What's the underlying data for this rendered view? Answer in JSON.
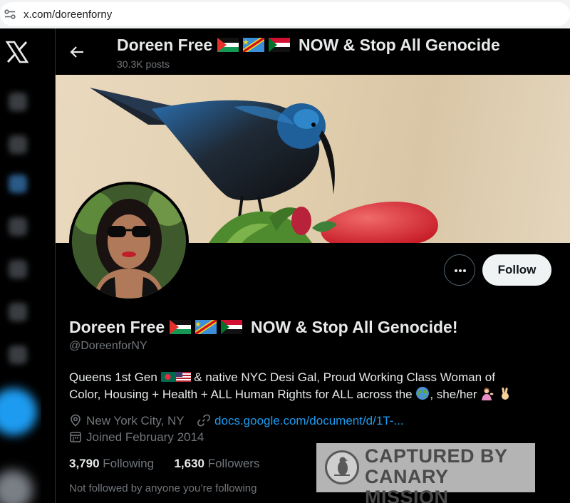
{
  "browser": {
    "url": "x.com/doreenforny"
  },
  "header": {
    "name_prefix": "Doreen Free",
    "name_suffix": "NOW & Stop All Genocide",
    "posts": "30.3K posts"
  },
  "profile": {
    "name_prefix": "Doreen Free",
    "name_suffix": "NOW & Stop All Genocide!",
    "handle": "@DoreenforNY",
    "bio_line1_a": "Queens 1st Gen",
    "bio_line1_b": "& native NYC Desi Gal, Proud Working Class Woman of",
    "bio_line2_a": "Color, Housing + Health + ALL Human Rights for ALL across the",
    "bio_line2_b": ", she/her",
    "location": "New York City, NY",
    "website": "docs.google.com/document/d/1T-...",
    "joined": "Joined February 2014",
    "following_count": "3,790",
    "following_label": "Following",
    "followers_count": "1,630",
    "followers_label": "Followers",
    "not_followed": "Not followed by anyone you’re following"
  },
  "buttons": {
    "follow": "Follow"
  },
  "watermark": {
    "line1": "CAPTURED BY",
    "line2": "CANARY MISSION"
  },
  "colors": {
    "accent": "#1d9bf0",
    "background": "#000000",
    "muted": "#71767b",
    "text": "#e7e9ea"
  },
  "icons": [
    "site-info-icon",
    "x-logo-icon",
    "back-arrow-icon",
    "more-options-icon",
    "location-icon",
    "link-icon",
    "calendar-icon",
    "canary-logo-icon"
  ]
}
